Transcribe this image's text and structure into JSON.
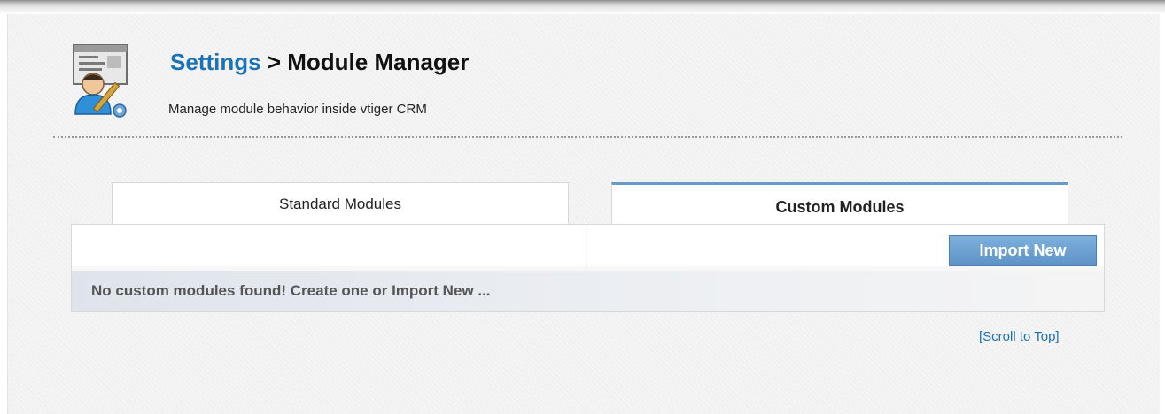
{
  "header": {
    "breadcrumb_link": "Settings",
    "breadcrumb_separator": ">",
    "title": "Module Manager",
    "subtitle": "Manage module behavior inside vtiger CRM",
    "icon": "settings-tools-icon"
  },
  "tabs": [
    {
      "label": "Standard Modules",
      "active": false
    },
    {
      "label": "Custom Modules",
      "active": true
    }
  ],
  "panel": {
    "import_button_label": "Import New",
    "empty_message": "No custom modules found! Create one or Import New ..."
  },
  "footer": {
    "scroll_to_top_label": "[Scroll to Top]"
  },
  "colors": {
    "link": "#1a73b5",
    "active_tab_border": "#6a9bc8",
    "button": "#5d93c7"
  }
}
